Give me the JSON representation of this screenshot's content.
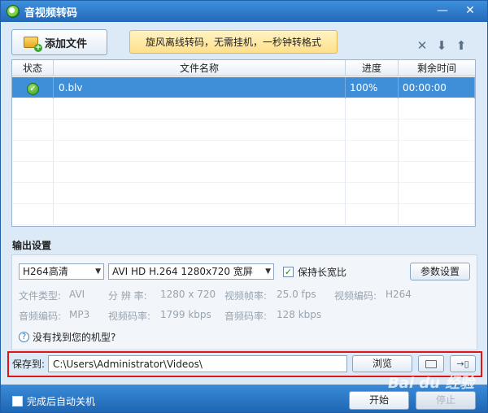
{
  "window": {
    "title": "音视频转码"
  },
  "toolbar": {
    "add_file_label": "添加文件",
    "banner_text": "旋风离线转码，无需挂机，一秒钟转格式"
  },
  "table": {
    "headers": {
      "status": "状态",
      "name": "文件名称",
      "progress": "进度",
      "remaining": "剩余时间"
    },
    "rows": [
      {
        "name": "0.blv",
        "progress": "100%",
        "remaining": "00:00:00",
        "status_icon": "check-circle-icon"
      }
    ]
  },
  "output": {
    "section_title": "输出设置",
    "quality": "H264高清",
    "format": "AVI HD H.264 1280x720 宽屏",
    "keep_ratio_label": "保持长宽比",
    "keep_ratio_checked": true,
    "params_button": "参数设置",
    "info": {
      "file_type_label": "文件类型:",
      "file_type": "AVI",
      "resolution_label": "分 辨 率:",
      "resolution": "1280 x 720",
      "video_fps_label": "视频帧率:",
      "video_fps": "25.0 fps",
      "video_codec_label": "视频编码:",
      "video_codec": "H264",
      "audio_codec_label": "音频编码:",
      "audio_codec": "MP3",
      "video_bitrate_label": "视频码率:",
      "video_bitrate": "1799 kbps",
      "audio_bitrate_label": "音频码率:",
      "audio_bitrate": "128 kbps"
    },
    "help_text": "没有找到您的机型?"
  },
  "save": {
    "label": "保存到:",
    "path": "C:\\Users\\Administrator\\Videos\\",
    "browse_button": "浏览"
  },
  "footer": {
    "shutdown_label": "完成后自动关机",
    "start_button": "开始",
    "stop_button": "停止"
  },
  "watermark": "Bai du 经验",
  "colors": {
    "accent": "#2a78c6",
    "selection": "#3f8fd8",
    "highlight_frame": "#e01616"
  }
}
